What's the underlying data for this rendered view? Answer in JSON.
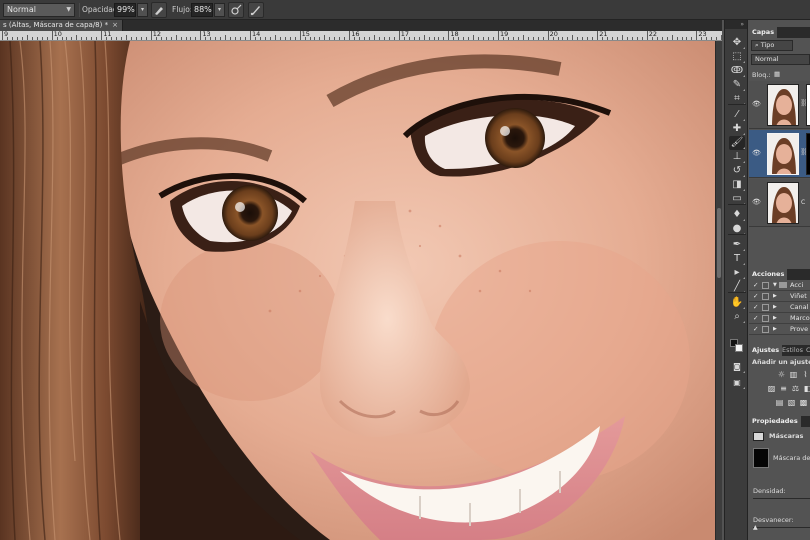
{
  "options_bar": {
    "mode_value": "Normal",
    "opacity_label": "Opacidad:",
    "opacity_value": "99%",
    "flow_label": "Flujo:",
    "flow_value": "88%"
  },
  "document_tab": {
    "title": "s (Altas, Máscara de capa/8) *",
    "close": "×"
  },
  "ruler": {
    "labels": [
      "9",
      "10",
      "11",
      "12",
      "13",
      "14",
      "15",
      "16",
      "17",
      "18",
      "19",
      "20",
      "21",
      "22",
      "23"
    ]
  },
  "layers_panel": {
    "tab_label": "Capas",
    "filter_value": "Tipo",
    "blend_value": "Normal",
    "lock_label": "Bloq.:",
    "layers": [
      {
        "name": ""
      },
      {
        "name": ""
      },
      {
        "name": "C"
      }
    ]
  },
  "actions_panel": {
    "tab_label": "Acciones",
    "items": [
      {
        "label": "Acci"
      },
      {
        "label": "Viñet"
      },
      {
        "label": "Canal"
      },
      {
        "label": "Marco"
      },
      {
        "label": "Prove"
      }
    ]
  },
  "adjustments_panel": {
    "tab_label": "Ajustes",
    "tab2_label": "Estilos",
    "tab3_label": "C",
    "heading": "Añadir un ajuste"
  },
  "properties_panel": {
    "tab_label": "Propiedades",
    "type_label": "Máscaras",
    "mask_label": "Máscara de c",
    "density_label": "Densidad:",
    "feather_label": "Desvanecer:"
  },
  "tools": {
    "expand_glyph": "»",
    "items": [
      {
        "name": "move-tool",
        "glyph": "✥"
      },
      {
        "name": "marquee-tool",
        "glyph": "⬚"
      },
      {
        "name": "lasso-tool",
        "glyph": "ↂ"
      },
      {
        "name": "quick-select-tool",
        "glyph": "✎"
      },
      {
        "name": "crop-tool",
        "glyph": "⌗"
      },
      {
        "name": "eyedropper-tool",
        "glyph": "⁄"
      },
      {
        "name": "healing-tool",
        "glyph": "✚"
      },
      {
        "name": "brush-tool",
        "glyph": "🖌"
      },
      {
        "name": "stamp-tool",
        "glyph": "⊥"
      },
      {
        "name": "history-brush-tool",
        "glyph": "↺"
      },
      {
        "name": "eraser-tool",
        "glyph": "◨"
      },
      {
        "name": "gradient-tool",
        "glyph": "▭"
      },
      {
        "name": "blur-tool",
        "glyph": "♦"
      },
      {
        "name": "dodge-tool",
        "glyph": "●"
      },
      {
        "name": "pen-tool",
        "glyph": "✒"
      },
      {
        "name": "type-tool",
        "glyph": "T"
      },
      {
        "name": "path-select-tool",
        "glyph": "▸"
      },
      {
        "name": "shape-tool",
        "glyph": "╱"
      },
      {
        "name": "hand-tool",
        "glyph": "✋"
      },
      {
        "name": "zoom-tool",
        "glyph": "⌕"
      }
    ]
  },
  "colors": {
    "panel_bg": "#535353",
    "dark_bar": "#2a2a2a",
    "selected_layer": "#3b5b84",
    "accent_eye": "#6b4020",
    "skin": "#e8b29a"
  }
}
